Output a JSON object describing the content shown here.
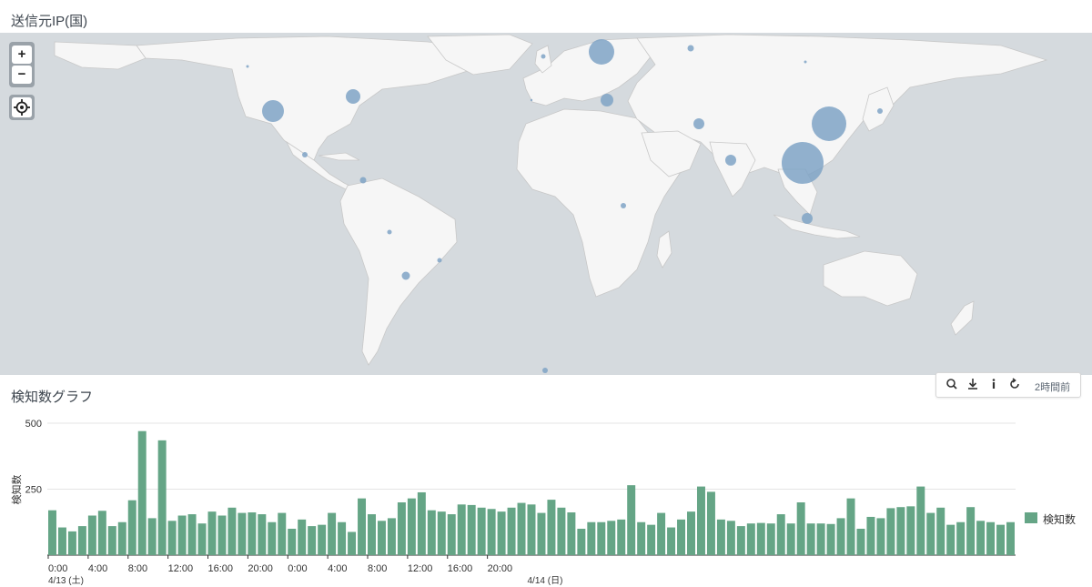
{
  "map_panel": {
    "title": "送信元IP(国)",
    "controls": {
      "zoom_in": "+",
      "zoom_out": "−"
    },
    "marker_color": "#7fa3c6"
  },
  "chart_panel": {
    "title": "検知数グラフ",
    "toolbar": {
      "time_ago": "2時間前"
    },
    "legend_label": "検知数",
    "bar_color": "#65a586"
  },
  "chart_data": {
    "type": "bar",
    "ylabel": "検知数",
    "ylim": [
      0,
      500
    ],
    "y_ticks": [
      500,
      250
    ],
    "x_tick_labels": [
      "0:00",
      "4:00",
      "8:00",
      "12:00",
      "16:00",
      "20:00",
      "0:00",
      "4:00",
      "8:00",
      "12:00",
      "16:00",
      "20:00"
    ],
    "x_date_labels": [
      "4/13 (土)",
      "4/14 (日)"
    ],
    "series": [
      {
        "name": "検知数",
        "values": [
          170,
          105,
          90,
          110,
          150,
          168,
          110,
          125,
          208,
          470,
          140,
          435,
          130,
          150,
          155,
          120,
          165,
          150,
          180,
          160,
          162,
          155,
          125,
          160,
          100,
          135,
          110,
          115,
          160,
          125,
          88,
          215,
          155,
          130,
          140,
          200,
          215,
          238,
          170,
          165,
          155,
          192,
          190,
          180,
          175,
          165,
          180,
          198,
          192,
          160,
          210,
          180,
          162,
          100,
          125,
          125,
          130,
          135,
          265,
          125,
          115,
          160,
          105,
          135,
          165,
          260,
          240,
          135,
          130,
          110,
          120,
          122,
          120,
          155,
          120,
          200,
          120,
          120,
          118,
          140,
          215,
          100,
          145,
          140,
          178,
          182,
          185,
          260,
          160,
          180,
          115,
          125,
          182,
          130,
          125,
          115,
          125
        ]
      }
    ]
  }
}
